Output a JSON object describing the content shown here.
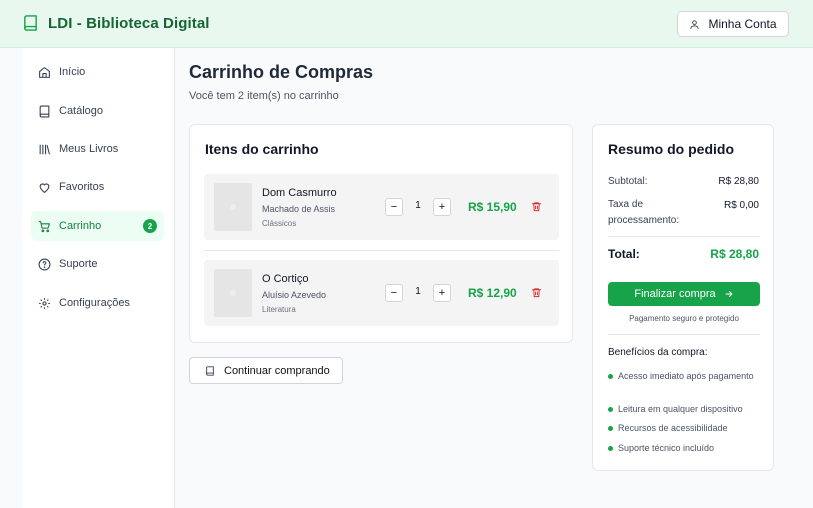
{
  "header": {
    "app_title": "LDI - Biblioteca Digital",
    "account_label": "Minha Conta"
  },
  "sidebar": {
    "items": [
      {
        "label": "Início",
        "icon": "home-icon"
      },
      {
        "label": "Catálogo",
        "icon": "book-icon"
      },
      {
        "label": "Meus Livros",
        "icon": "library-icon"
      },
      {
        "label": "Favoritos",
        "icon": "heart-icon"
      },
      {
        "label": "Carrinho",
        "icon": "cart-icon",
        "active": true,
        "badge": "2"
      },
      {
        "label": "Suporte",
        "icon": "help-circle-icon"
      },
      {
        "label": "Configurações",
        "icon": "gear-icon"
      }
    ]
  },
  "page": {
    "title": "Carrinho de Compras",
    "subtitle": "Você tem 2 item(s) no carrinho"
  },
  "cart": {
    "title": "Itens do carrinho",
    "items": [
      {
        "title": "Dom Casmurro",
        "author": "Machado de Assis",
        "category": "Clássicos",
        "quantity": "1",
        "price": "R$ 15,90"
      },
      {
        "title": "O Cortiço",
        "author": "Aluísio Azevedo",
        "category": "Literatura",
        "quantity": "1",
        "price": "R$ 12,90"
      }
    ],
    "minus_symbol": "−",
    "plus_symbol": "+"
  },
  "continue_label": "Continuar comprando",
  "summary": {
    "title": "Resumo do pedido",
    "subtotal_label": "Subtotal:",
    "subtotal_value": "R$ 28,80",
    "fee_label": "Taxa de processamento:",
    "fee_value": "R$ 0,00",
    "total_label": "Total:",
    "total_value": "R$ 28,80",
    "checkout_label": "Finalizar compra",
    "secure_note": "Pagamento seguro e protegido",
    "benefits_title": "Benefícios da compra:",
    "benefits": [
      "Acesso imediato após pagamento",
      "Leitura em qualquer dispositivo",
      "Recursos de acessibilidade",
      "Suporte técnico incluído"
    ]
  },
  "colors": {
    "brand": "#166534",
    "accent": "#16a34a",
    "danger": "#dc2626",
    "header_bg": "#e8f8ee"
  }
}
